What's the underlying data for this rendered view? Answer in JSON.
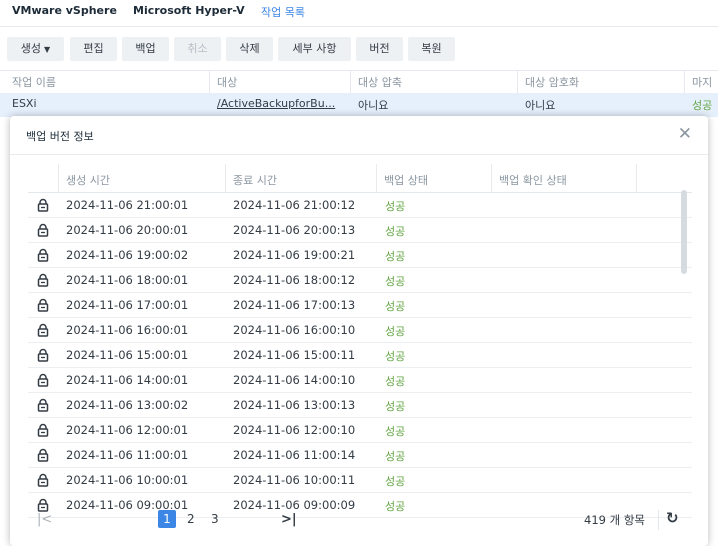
{
  "tabs": [
    "VMware vSphere",
    "Microsoft Hyper-V",
    "작업 목록"
  ],
  "toolbar": {
    "create": "생성",
    "edit": "편집",
    "backup": "백업",
    "cancel": "취소",
    "delete": "삭제",
    "details": "세부 사항",
    "version": "버전",
    "restore": "복원"
  },
  "bg_table": {
    "headers": [
      "작업 이름",
      "대상",
      "대상 압축",
      "대상 암호화",
      "마지"
    ],
    "row": {
      "name": "ESXi",
      "target": "/ActiveBackupforBu...",
      "compression": "아니요",
      "encryption": "아니요",
      "last": "성공"
    }
  },
  "modal": {
    "title": "백업 버전 정보",
    "columns": [
      "생성 시간",
      "종료 시간",
      "백업 상태",
      "백업 확인 상태"
    ],
    "rows": [
      {
        "created": "2024-11-06 21:00:01",
        "ended": "2024-11-06 21:00:12",
        "status": "성공"
      },
      {
        "created": "2024-11-06 20:00:01",
        "ended": "2024-11-06 20:00:13",
        "status": "성공"
      },
      {
        "created": "2024-11-06 19:00:02",
        "ended": "2024-11-06 19:00:21",
        "status": "성공"
      },
      {
        "created": "2024-11-06 18:00:01",
        "ended": "2024-11-06 18:00:12",
        "status": "성공"
      },
      {
        "created": "2024-11-06 17:00:01",
        "ended": "2024-11-06 17:00:13",
        "status": "성공"
      },
      {
        "created": "2024-11-06 16:00:01",
        "ended": "2024-11-06 16:00:10",
        "status": "성공"
      },
      {
        "created": "2024-11-06 15:00:01",
        "ended": "2024-11-06 15:00:11",
        "status": "성공"
      },
      {
        "created": "2024-11-06 14:00:01",
        "ended": "2024-11-06 14:00:10",
        "status": "성공"
      },
      {
        "created": "2024-11-06 13:00:02",
        "ended": "2024-11-06 13:00:13",
        "status": "성공"
      },
      {
        "created": "2024-11-06 12:00:01",
        "ended": "2024-11-06 12:00:10",
        "status": "성공"
      },
      {
        "created": "2024-11-06 11:00:01",
        "ended": "2024-11-06 11:00:14",
        "status": "성공"
      },
      {
        "created": "2024-11-06 10:00:01",
        "ended": "2024-11-06 10:00:11",
        "status": "성공"
      },
      {
        "created": "2024-11-06 09:00:01",
        "ended": "2024-11-06 09:00:09",
        "status": "성공"
      }
    ],
    "pager": {
      "pages": [
        "1",
        "2",
        "3"
      ],
      "current": "1",
      "total": "419 개 항목"
    }
  },
  "colors": {
    "accent": "#3c86e6",
    "success": "#63a543",
    "selected_row": "#e6f0fc"
  },
  "icons": {
    "row": "lock-icon",
    "close": "close-icon",
    "refresh": "refresh-icon"
  }
}
